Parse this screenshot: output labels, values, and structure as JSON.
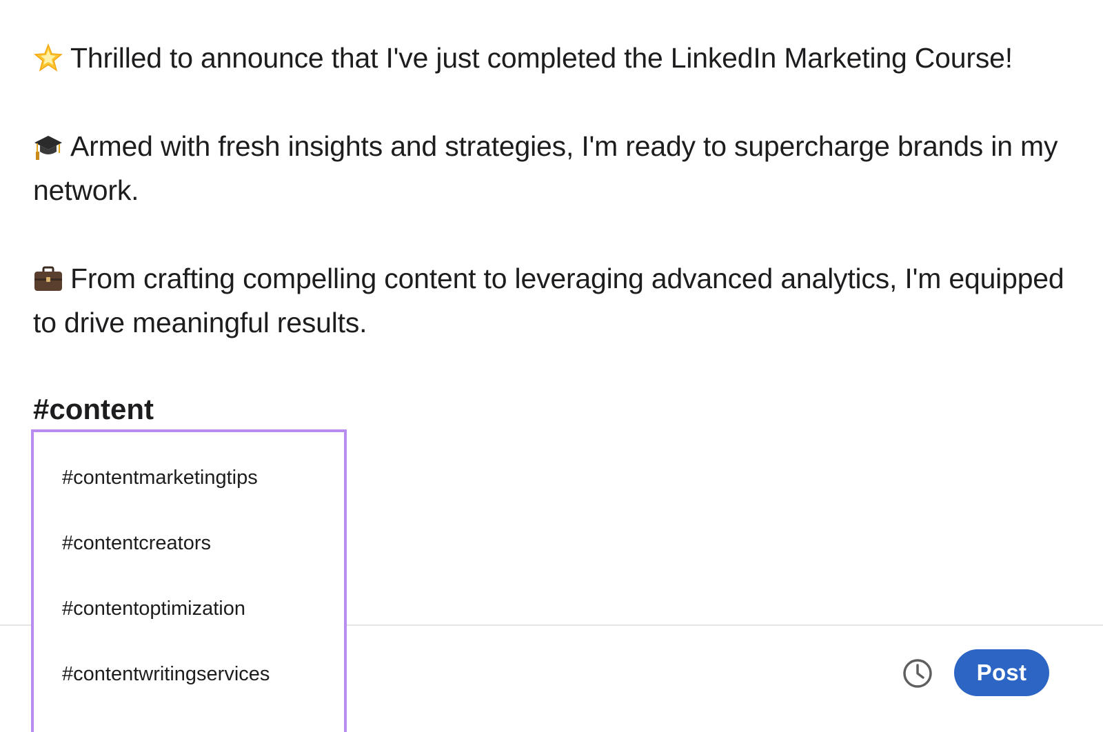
{
  "post": {
    "paragraphs": [
      {
        "icon": "glowing-star-icon",
        "text": "Thrilled to announce that I've just completed the LinkedIn Marketing Course!"
      },
      {
        "icon": "graduation-cap-icon",
        "text": "Armed with fresh insights and strategies, I'm ready to supercharge brands in my network."
      },
      {
        "icon": "briefcase-icon",
        "text": "From crafting compelling content to leveraging advanced analytics, I'm equipped to drive meaningful results."
      }
    ],
    "typed_hashtag": "#content"
  },
  "hashtag_suggestions": {
    "border_color": "#b98cf0",
    "items": [
      "#contentmarketingtips",
      "#contentcreators",
      "#contentoptimization",
      "#contentwritingservices"
    ]
  },
  "footer": {
    "schedule_icon": "clock-icon",
    "post_label": "Post",
    "post_button_color": "#2d65c4"
  }
}
